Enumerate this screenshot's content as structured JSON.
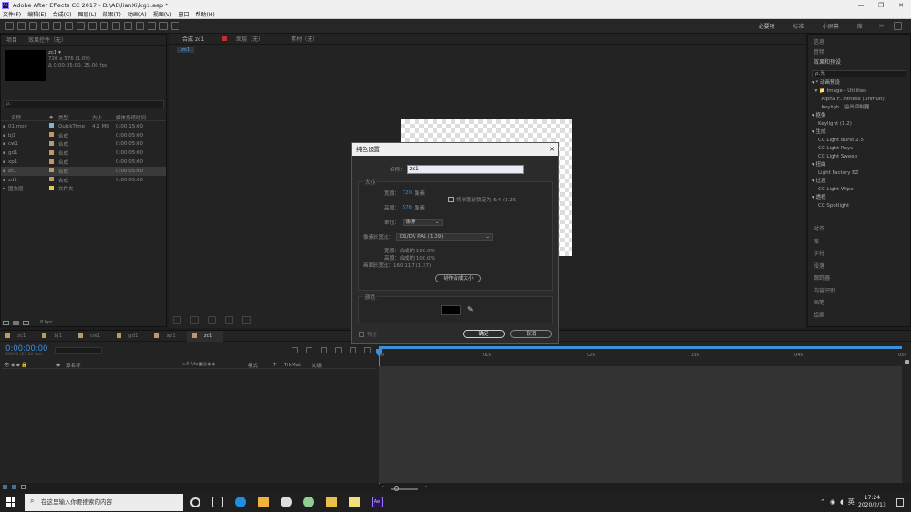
{
  "window": {
    "title": "Adobe After Effects CC 2017 - D:\\AE\\lianXi\\kg1.aep *",
    "min": "—",
    "max": "❐",
    "close": "✕"
  },
  "menu": [
    "文件(F)",
    "编辑(E)",
    "合成(C)",
    "图层(L)",
    "效果(T)",
    "动画(A)",
    "视图(V)",
    "窗口",
    "帮助(H)"
  ],
  "workspaces": [
    "必要项",
    "标准",
    "小屏幕",
    "库"
  ],
  "project": {
    "tab_project": "项目",
    "tab_effects_ctrl": "效果控件（无）",
    "selected_name": "zc1 ▾",
    "selected_info1": "720 x 576 (1.09)",
    "selected_info2": "Δ 0:00:05:00, 25.00 fps",
    "search_placeholder": "ρ.",
    "headers": [
      "名称",
      "类型",
      "大小",
      "媒体持续时间"
    ],
    "items": [
      {
        "name": "01.mov",
        "color": "#7bb3d6",
        "type": "QuickTime",
        "size": "4.1 MB",
        "dur": "0:00:15:00"
      },
      {
        "name": "bj1",
        "color": "#b99a6a",
        "type": "合成",
        "size": "",
        "dur": "0:00:05:00"
      },
      {
        "name": "cw1",
        "color": "#b99a6a",
        "type": "合成",
        "size": "",
        "dur": "0:00:05:00"
      },
      {
        "name": "gd1",
        "color": "#b99a6a",
        "type": "合成",
        "size": "",
        "dur": "0:00:05:00"
      },
      {
        "name": "xp1",
        "color": "#b99a6a",
        "type": "合成",
        "size": "",
        "dur": "0:00:05:00"
      },
      {
        "name": "zc1",
        "color": "#b99a6a",
        "type": "合成",
        "size": "",
        "dur": "0:00:05:00"
      },
      {
        "name": "zd1",
        "color": "#b99a6a",
        "type": "合成",
        "size": "",
        "dur": "0:00:05:00"
      },
      {
        "name": "固态层",
        "color": "#e2cc4a",
        "type": "文件夹",
        "size": "",
        "dur": ""
      }
    ],
    "bpc": "8 bpc"
  },
  "composition": {
    "tab_label": "合成 zc1",
    "layer_tab": "图层（无）",
    "footage_tab": "素材（无）",
    "breadcrumb": "zc1"
  },
  "effects": {
    "tabs": [
      "信息",
      "音频",
      "效果和预设",
      "对齐",
      "库",
      "字符",
      "段落",
      "跟踪器",
      "内容识别",
      "画笔",
      "绘画"
    ],
    "search_value": "ρ.光",
    "tree": [
      {
        "t": "▾ * 动画预设",
        "h": true
      },
      {
        "t": "  ▾ 📁 Image - Utilities",
        "h": false
      },
      {
        "t": "      Alpha F...htness (Unmult)",
        "h": false
      },
      {
        "t": "      Keyligh...溢出抑制器",
        "h": false
      },
      {
        "t": "▾ 抠像",
        "h": true
      },
      {
        "t": "    Keylight (1.2)",
        "h": false
      },
      {
        "t": "▾ 生成",
        "h": true
      },
      {
        "t": "    CC Light Burst 2.5",
        "h": false
      },
      {
        "t": "    CC Light Rays",
        "h": false
      },
      {
        "t": "    CC Light Sweep",
        "h": false
      },
      {
        "t": "▾ 扭曲",
        "h": true
      },
      {
        "t": "    Light Factory EZ",
        "h": false
      },
      {
        "t": "▾ 过渡",
        "h": true
      },
      {
        "t": "    CC Light Wipe",
        "h": false
      },
      {
        "t": "▾ 透视",
        "h": true
      },
      {
        "t": "    CC Spotlight",
        "h": false
      }
    ]
  },
  "timeline": {
    "tabs": [
      "zc1",
      "bj1",
      "cw1",
      "gd1",
      "xp1",
      "zc1"
    ],
    "timecode": "0:00:00:00",
    "fps": "00000 (25.00 fps)",
    "col_source": "源名称",
    "col_mode": "模式",
    "col_t": "T",
    "col_trkmat": "TrkMat",
    "col_parent": "父级",
    "ruler": [
      "0s",
      "01s",
      "02s",
      "03s",
      "04s",
      "05s"
    ]
  },
  "dialog": {
    "title": "纯色设置",
    "close": "✕",
    "name_label": "名称：",
    "name_value": "zc1",
    "size_group": "大小",
    "width_label": "宽度：",
    "width_value": "720",
    "width_unit": "像素",
    "height_label": "高度：",
    "height_value": "576",
    "height_unit": "像素",
    "lock_label": "将长宽比锁定为 5:4 (1.25)",
    "units_label": "单位：",
    "units_value": "像素",
    "par_label": "像素长宽比：",
    "par_value": "D1/DV PAL (1.09)",
    "pct_width": "宽度：合成的 100.0%",
    "pct_height": "高度：合成的 100.0%",
    "frame_ratio": "画面长宽比：160:117 (1.37)",
    "make_comp_size": "制作合成大小",
    "color_group": "颜色",
    "swatch_color": "#000000",
    "preview_label": "预览",
    "ok": "确定",
    "cancel": "取消"
  },
  "taskbar": {
    "search": "在这里输入你要搜索的内容",
    "time": "17:24",
    "date": "2020/2/13",
    "ime": "英"
  }
}
